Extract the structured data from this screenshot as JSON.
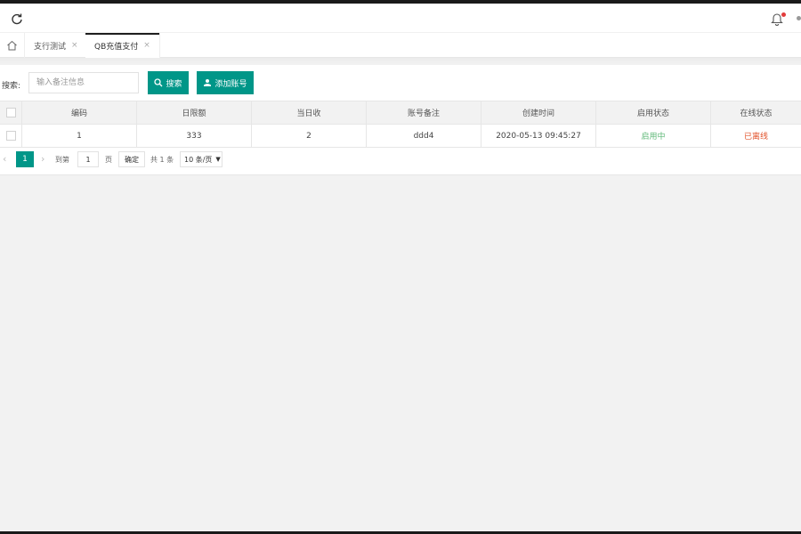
{
  "topbar": {
    "refresh_icon": "refresh-icon",
    "bell_icon": "bell-icon"
  },
  "tabs": {
    "home_icon": "home-icon",
    "items": [
      {
        "label": "支行测试",
        "close": "×"
      },
      {
        "label": "QB充值支付",
        "close": "×"
      }
    ]
  },
  "search": {
    "label": "搜索:",
    "placeholder": "输入备注信息",
    "search_button": "搜索",
    "add_button": "添加账号"
  },
  "table": {
    "columns": [
      "编码",
      "日限额",
      "当日收",
      "账号备注",
      "创建时间",
      "启用状态",
      "在线状态"
    ],
    "rows": [
      {
        "id": "1",
        "daily_limit": "333",
        "today": "2",
        "note": "ddd4",
        "created": "2020-05-13 09:45:27",
        "enabled": "启用中",
        "online": "已离线"
      }
    ]
  },
  "pager": {
    "prev": "‹",
    "current": "1",
    "next": "›",
    "goto_label": "到第",
    "goto_value": "1",
    "page_label": "页",
    "confirm": "确定",
    "total": "共 1 条",
    "page_size": "10 条/页"
  },
  "colors": {
    "primary": "#009688",
    "enabled": "#5fb878",
    "offline": "#e2532c",
    "notification": "#e23c3c"
  }
}
